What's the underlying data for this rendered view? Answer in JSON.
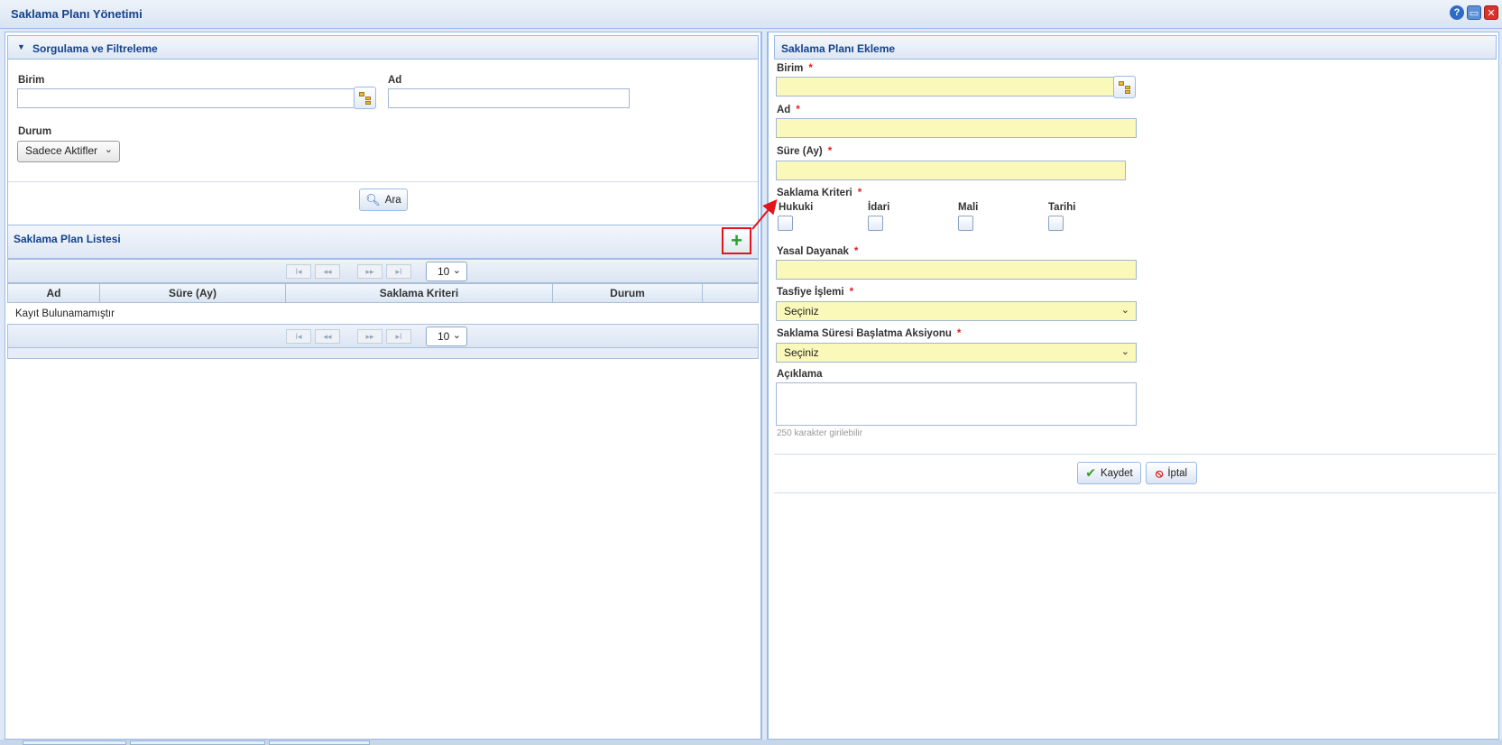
{
  "window": {
    "title": "Saklama Planı Yönetimi",
    "icons": [
      "help-icon",
      "window-icon",
      "close-icon"
    ]
  },
  "filter": {
    "title": "Sorgulama ve Filtreleme",
    "birim_label": "Birim",
    "birim_value": "",
    "ad_label": "Ad",
    "ad_value": "",
    "durum_label": "Durum",
    "durum_value": "Sadece Aktifler",
    "search_button": "Ara"
  },
  "list": {
    "title": "Saklama Plan Listesi",
    "page_size": "10",
    "columns": [
      "Ad",
      "Süre (Ay)",
      "Saklama Kriteri",
      "Durum"
    ],
    "empty_text": "Kayıt Bulunamamıştır"
  },
  "form": {
    "title": "Saklama Planı Ekleme",
    "birim_label": "Birim",
    "ad_label": "Ad",
    "sure_label": "Süre (Ay)",
    "kriter_label": "Saklama Kriteri",
    "kriter_options": [
      "Hukuki",
      "İdari",
      "Mali",
      "Tarihi"
    ],
    "yasal_label": "Yasal Dayanak",
    "tasfiye_label": "Tasfiye İşlemi",
    "tasfiye_value": "Seçiniz",
    "baslatma_label": "Saklama Süresi Başlatma Aksiyonu",
    "baslatma_value": "Seçiniz",
    "aciklama_label": "Açıklama",
    "aciklama_hint": "250 karakter girilebilir",
    "required_mark": "*",
    "save_button": "Kaydet",
    "cancel_button": "İptal"
  },
  "colors": {
    "required_bg": "#fbf9b9",
    "highlight": "#e0161b",
    "header_text": "#15428b"
  }
}
